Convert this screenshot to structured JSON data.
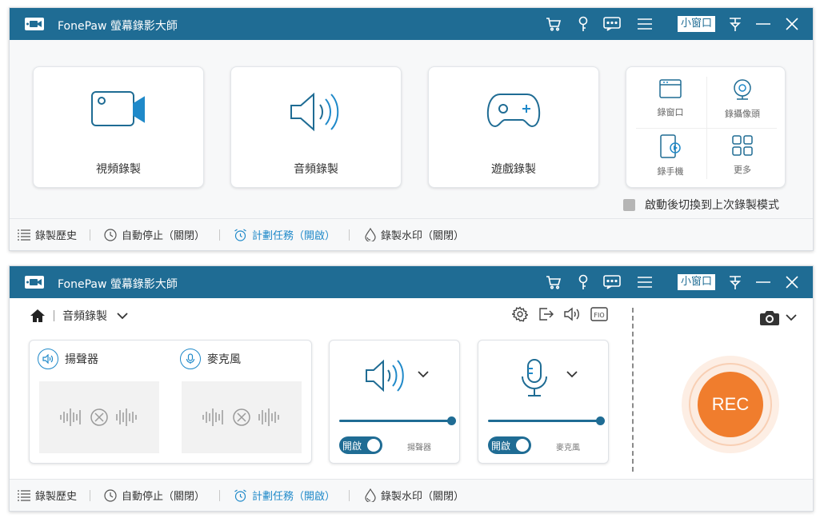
{
  "app": {
    "title": "FonePaw 螢幕錄影大師",
    "mini_window": "小窗口"
  },
  "colors": {
    "titlebar": "#1f6c94",
    "accent": "#1f89c9",
    "rec": "#f07d2d"
  },
  "home": {
    "cards": [
      {
        "label": "視頻錄製",
        "icon": "video-camera-icon"
      },
      {
        "label": "音頻錄製",
        "icon": "speaker-icon"
      },
      {
        "label": "遊戲錄製",
        "icon": "gamepad-icon"
      }
    ],
    "more_grid": [
      {
        "label": "錄窗口",
        "icon": "window-icon"
      },
      {
        "label": "錄攝像頭",
        "icon": "webcam-icon"
      },
      {
        "label": "錄手機",
        "icon": "phone-icon"
      },
      {
        "label": "更多",
        "icon": "grid-icon"
      }
    ],
    "checkbox_label": "啟動後切換到上次錄製模式"
  },
  "footer": {
    "history": "錄製歷史",
    "auto_stop": "自動停止（關閉）",
    "schedule": "計劃任務（開啟）",
    "watermark": "錄製水印（關閉）"
  },
  "audio": {
    "mode": "音頻錄製",
    "speaker_label": "揚聲器",
    "mic_label": "麥克風",
    "toggle_on": "開啟",
    "speaker_level": 1.0,
    "mic_level": 1.0,
    "rec_label": "REC"
  }
}
